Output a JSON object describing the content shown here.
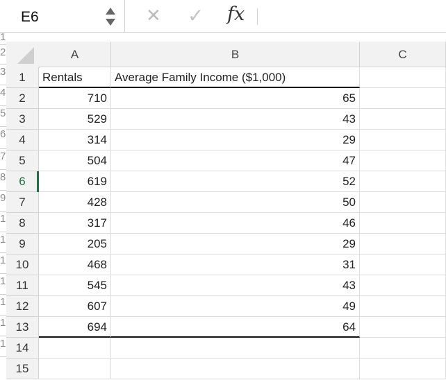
{
  "formula_bar": {
    "name_box": "E6",
    "cancel_icon": "✕",
    "enter_icon": "✓",
    "function_label": "fx",
    "formula_value": ""
  },
  "gutter_numbers": [
    "1",
    "2",
    "3",
    "4",
    "5",
    "6",
    "7",
    "8",
    "9",
    "1",
    "1",
    "1",
    "1",
    "1",
    "1",
    "1"
  ],
  "columns": [
    "A",
    "B",
    "C"
  ],
  "rows": [
    {
      "num": "1",
      "a": "Rentals",
      "b": "Average Family Income ($1,000)"
    },
    {
      "num": "2",
      "a": "710",
      "b": "65"
    },
    {
      "num": "3",
      "a": "529",
      "b": "43"
    },
    {
      "num": "4",
      "a": "314",
      "b": "29"
    },
    {
      "num": "5",
      "a": "504",
      "b": "47"
    },
    {
      "num": "6",
      "a": "619",
      "b": "52"
    },
    {
      "num": "7",
      "a": "428",
      "b": "50"
    },
    {
      "num": "8",
      "a": "317",
      "b": "46"
    },
    {
      "num": "9",
      "a": "205",
      "b": "29"
    },
    {
      "num": "10",
      "a": "468",
      "b": "31"
    },
    {
      "num": "11",
      "a": "545",
      "b": "43"
    },
    {
      "num": "12",
      "a": "607",
      "b": "49"
    },
    {
      "num": "13",
      "a": "694",
      "b": "64"
    },
    {
      "num": "14",
      "a": "",
      "b": ""
    },
    {
      "num": "15",
      "a": "",
      "b": ""
    }
  ],
  "active_row": "6",
  "colors": {
    "active": "#1e7145",
    "header_bg": "#f2f2f2",
    "grid_line": "#dcdcdc"
  }
}
